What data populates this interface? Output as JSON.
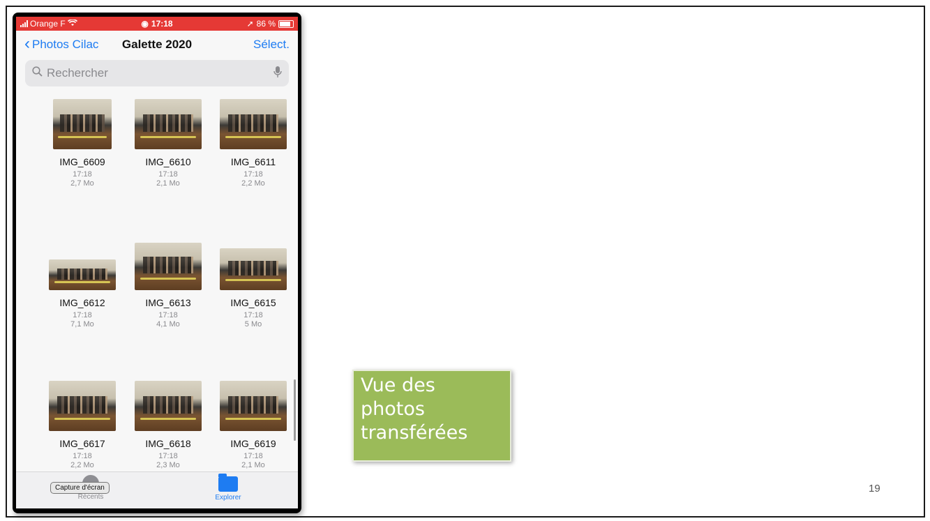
{
  "status_bar": {
    "carrier": "Orange F",
    "time": "17:18",
    "battery": "86 %"
  },
  "nav": {
    "back_label": "Photos Cilac",
    "title": "Galette 2020",
    "select_label": "Sélect."
  },
  "search": {
    "placeholder": "Rechercher"
  },
  "files": [
    {
      "name": "IMG_6609",
      "time": "17:18",
      "size": "2,7 Mo"
    },
    {
      "name": "IMG_6610",
      "time": "17:18",
      "size": "2,1 Mo"
    },
    {
      "name": "IMG_6611",
      "time": "17:18",
      "size": "2,2 Mo"
    },
    {
      "name": "IMG_6612",
      "time": "17:18",
      "size": "7,1 Mo"
    },
    {
      "name": "IMG_6613",
      "time": "17:18",
      "size": "4,1 Mo"
    },
    {
      "name": "IMG_6615",
      "time": "17:18",
      "size": "5 Mo"
    },
    {
      "name": "IMG_6617",
      "time": "17:18",
      "size": "2,2 Mo"
    },
    {
      "name": "IMG_6618",
      "time": "17:18",
      "size": "2,3 Mo"
    },
    {
      "name": "IMG_6619",
      "time": "17:18",
      "size": "2,1 Mo"
    }
  ],
  "tabbar": {
    "recents_label": "Récents",
    "explorer_label": "Explorer",
    "tooltip": "Capture d'écran"
  },
  "caption": {
    "line1": "Vue des",
    "line2": "photos",
    "line3": "transférées"
  },
  "page_number": "19",
  "colors": {
    "status_bar": "#e53935",
    "accent": "#1e7cf2",
    "caption_bg": "#9bbb59"
  }
}
